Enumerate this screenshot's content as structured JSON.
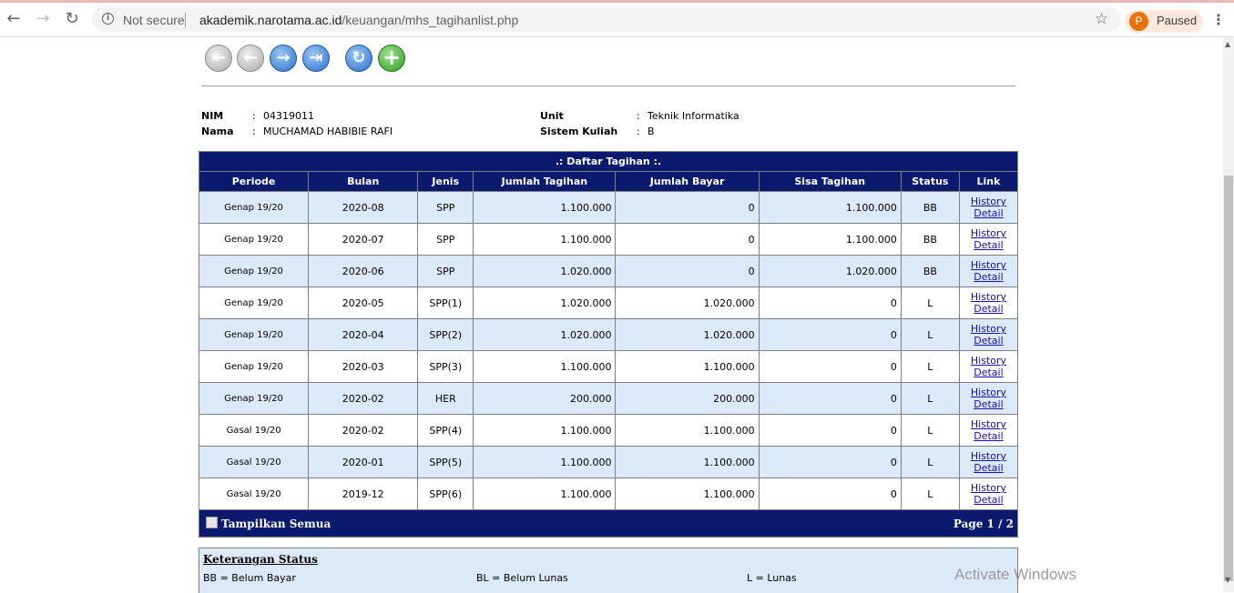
{
  "browser": {
    "back_icon": "arrow-left-icon",
    "security_label": "Not secure",
    "url_host": "akademik.narotama.ac.id",
    "url_path": "/keuangan/mhs_tagihanlist.php",
    "profile_initial": "P",
    "profile_status": "Paused",
    "accent_color": "#e8710a"
  },
  "nav_icons": [
    "first-icon",
    "previous-icon",
    "next-icon",
    "last-icon",
    "refresh-icon",
    "add-icon"
  ],
  "student": {
    "nim_label": "NIM",
    "nim_value": "04319011",
    "nama_label": "Nama",
    "nama_value": "MUCHAMAD HABIBIE RAFI",
    "unit_label": "Unit",
    "unit_value": "Teknik Informatika",
    "sistem_label": "Sistem Kuliah",
    "sistem_value": "B",
    "colon": ":"
  },
  "table": {
    "title": ".: Daftar Tagihan :.",
    "header_color": "#0a1a6e",
    "columns": [
      "Periode",
      "Bulan",
      "Jenis",
      "Jumlah Tagihan",
      "Jumlah Bayar",
      "Sisa Tagihan",
      "Status",
      "Link"
    ],
    "rows": [
      {
        "periode": "Genap 19/20",
        "bulan": "2020-08",
        "jenis": "SPP",
        "tagihan": "1.100.000",
        "bayar": "0",
        "sisa": "1.100.000",
        "status": "BB",
        "link1": "History",
        "link2": "Detail"
      },
      {
        "periode": "Genap 19/20",
        "bulan": "2020-07",
        "jenis": "SPP",
        "tagihan": "1.100.000",
        "bayar": "0",
        "sisa": "1.100.000",
        "status": "BB",
        "link1": "History",
        "link2": "Detail"
      },
      {
        "periode": "Genap 19/20",
        "bulan": "2020-06",
        "jenis": "SPP",
        "tagihan": "1.020.000",
        "bayar": "0",
        "sisa": "1.020.000",
        "status": "BB",
        "link1": "History",
        "link2": "Detail"
      },
      {
        "periode": "Genap 19/20",
        "bulan": "2020-05",
        "jenis": "SPP(1)",
        "tagihan": "1.020.000",
        "bayar": "1.020.000",
        "sisa": "0",
        "status": "L",
        "link1": "History",
        "link2": "Detail"
      },
      {
        "periode": "Genap 19/20",
        "bulan": "2020-04",
        "jenis": "SPP(2)",
        "tagihan": "1.020.000",
        "bayar": "1.020.000",
        "sisa": "0",
        "status": "L",
        "link1": "History",
        "link2": "Detail"
      },
      {
        "periode": "Genap 19/20",
        "bulan": "2020-03",
        "jenis": "SPP(3)",
        "tagihan": "1.100.000",
        "bayar": "1.100.000",
        "sisa": "0",
        "status": "L",
        "link1": "History",
        "link2": "Detail"
      },
      {
        "periode": "Genap 19/20",
        "bulan": "2020-02",
        "jenis": "HER",
        "tagihan": "200.000",
        "bayar": "200.000",
        "sisa": "0",
        "status": "L",
        "link1": "History",
        "link2": "Detail"
      },
      {
        "periode": "Gasal 19/20",
        "bulan": "2020-02",
        "jenis": "SPP(4)",
        "tagihan": "1.100.000",
        "bayar": "1.100.000",
        "sisa": "0",
        "status": "L",
        "link1": "History",
        "link2": "Detail"
      },
      {
        "periode": "Gasal 19/20",
        "bulan": "2020-01",
        "jenis": "SPP(5)",
        "tagihan": "1.100.000",
        "bayar": "1.100.000",
        "sisa": "0",
        "status": "L",
        "link1": "History",
        "link2": "Detail"
      },
      {
        "periode": "Gasal 19/20",
        "bulan": "2019-12",
        "jenis": "SPP(6)",
        "tagihan": "1.100.000",
        "bayar": "1.100.000",
        "sisa": "0",
        "status": "L",
        "link1": "History",
        "link2": "Detail"
      }
    ],
    "show_all_label": "Tampilkan Semua",
    "page_label": "Page 1 / 2"
  },
  "keterangan": {
    "title": "Keterangan Status",
    "items": [
      "BB = Belum Bayar",
      "BL = Belum Lunas",
      "L = Lunas"
    ]
  },
  "watermark": "Activate Windows"
}
